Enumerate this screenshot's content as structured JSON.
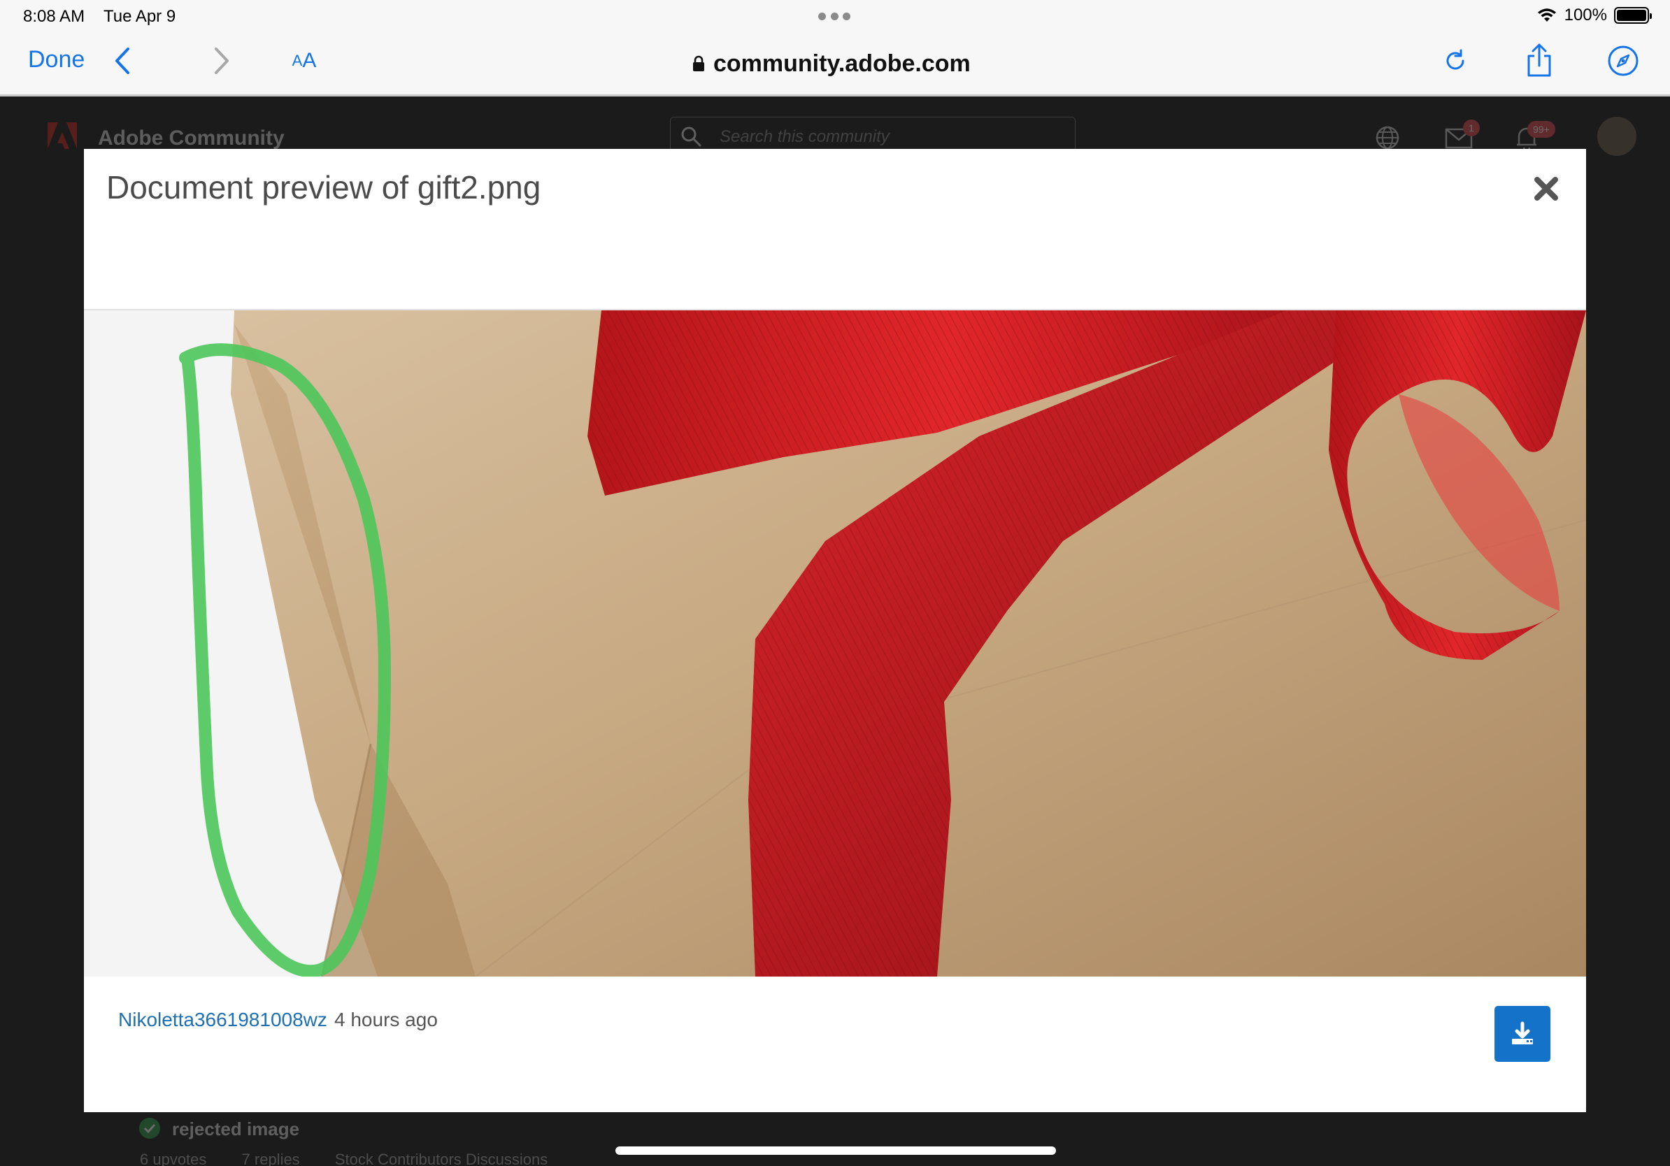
{
  "status_bar": {
    "time": "8:08 AM",
    "date": "Tue Apr 9",
    "battery": "100%"
  },
  "safari": {
    "done_label": "Done",
    "reader_label_small": "A",
    "reader_label_large": "A",
    "url": "community.adobe.com",
    "accent_color": "#1474e8"
  },
  "background_page": {
    "site_name": "Adobe Community",
    "search_placeholder": "Search this community",
    "mail_badge": "1",
    "notification_badge": "99+",
    "topic_title": "rejected image",
    "topic_meta": [
      "6 upvotes",
      "7 replies",
      "Stock Contributors Discussions"
    ]
  },
  "modal": {
    "title": "Document preview of gift2.png",
    "author": "Nikoletta3661981008wz",
    "time_ago": "4 hours ago",
    "download_color": "#1473c8",
    "image_description_icon": "gift-photo-with-green-annotation"
  },
  "icons": {
    "back": "chevron-left-icon",
    "forward": "chevron-right-icon",
    "lock": "lock-icon",
    "reload": "reload-icon",
    "share": "share-icon",
    "compass": "compass-icon",
    "close": "close-icon",
    "download": "download-icon"
  }
}
